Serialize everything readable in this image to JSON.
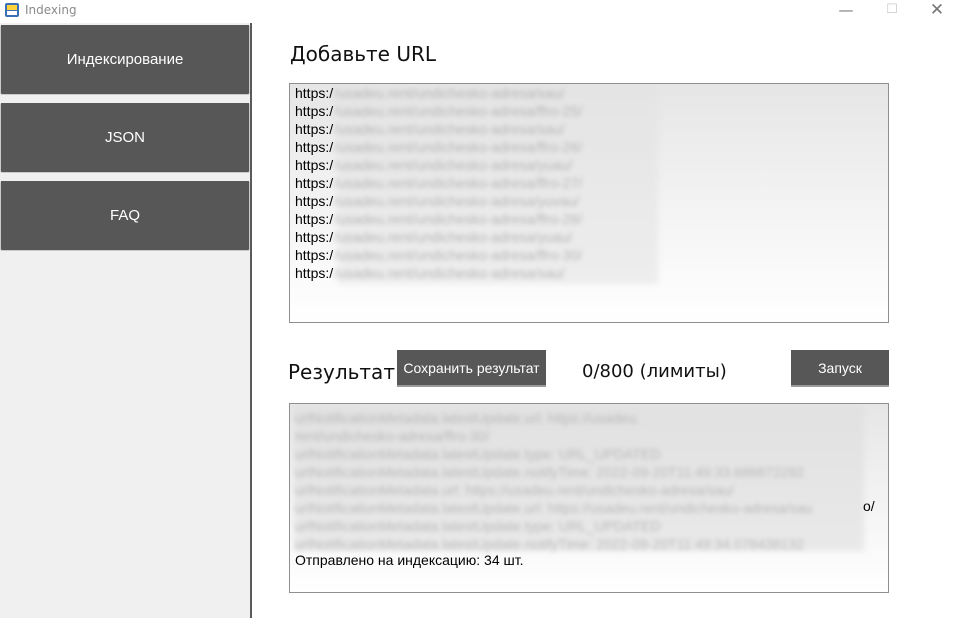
{
  "window": {
    "title": "Indexing",
    "minimize_glyph": "—",
    "maximize_glyph": "☐",
    "close_glyph": "✕"
  },
  "sidebar": {
    "items": [
      {
        "label": "Индексирование"
      },
      {
        "label": "JSON"
      },
      {
        "label": "FAQ"
      }
    ]
  },
  "main": {
    "url_title": "Добавьте URL",
    "url_lines": [
      {
        "proto": "https:/",
        "rest": "/usadeu.rent/undichesko-adresa/sau/"
      },
      {
        "proto": "https:/",
        "rest": "/usadeu.rent/undichesko-adresa/ffro-25/"
      },
      {
        "proto": "https:/",
        "rest": "/usadeu.rent/undichesko-adresa/sau/"
      },
      {
        "proto": "https:/",
        "rest": "/usadeu.rent/undichesko-adresa/ffro-26/"
      },
      {
        "proto": "https:/",
        "rest": "/usadeu.rent/undichesko-adresa/yuau/"
      },
      {
        "proto": "https:/",
        "rest": "/usadeu.rent/undichesko-adresa/ffro-27/"
      },
      {
        "proto": "https:/",
        "rest": "/usadeu.rent/undichesko-adresa/yuvau/"
      },
      {
        "proto": "https:/",
        "rest": "/usadeu.rent/undichesko-adresa/ffro-28/"
      },
      {
        "proto": "https:/",
        "rest": "/usadeu.rent/undichesko-adresa/yuau/"
      },
      {
        "proto": "https:/",
        "rest": "/usadeu.rent/undichesko-adresa/ffro-30/"
      },
      {
        "proto": "https:/",
        "rest": "/usadeu.rent/undichesko-adresa/sau/"
      }
    ],
    "result_title": "Результат",
    "save_button": "Сохранить результат",
    "limits_text": "0/800 (лимиты)",
    "run_button": "Запуск",
    "result_lines": [
      "urlNotificationMetadata.latestUpdate.url: https://usadeu.",
      "rent/undichesko-adresa/ffro-30/",
      "urlNotificationMetadata.latestUpdate.type: URL_UPDATED",
      "urlNotificationMetadata.latestUpdate.notifyTime: 2022-09-20T11:49:33.686872292",
      "urlNotificationMetadata.url: https://usadeu.rent/undichesko-adresa/sau/",
      "urlNotificationMetadata.latestUpdate.url: https://usadeu.rent/undichesko-adresa/sau",
      "urlNotificationMetadata.latestUpdate.type: URL_UPDATED",
      "urlNotificationMetadata.latestUpdate.notifyTime: 2022-09-20T11:49:34.078438132"
    ],
    "result_tail": "o/",
    "result_final": "Отправлено на индексацию: 34 шт."
  },
  "colors": {
    "button_bg": "#575757",
    "sidebar_bg": "#f0f0f0",
    "divider": "#5a5a5a"
  }
}
